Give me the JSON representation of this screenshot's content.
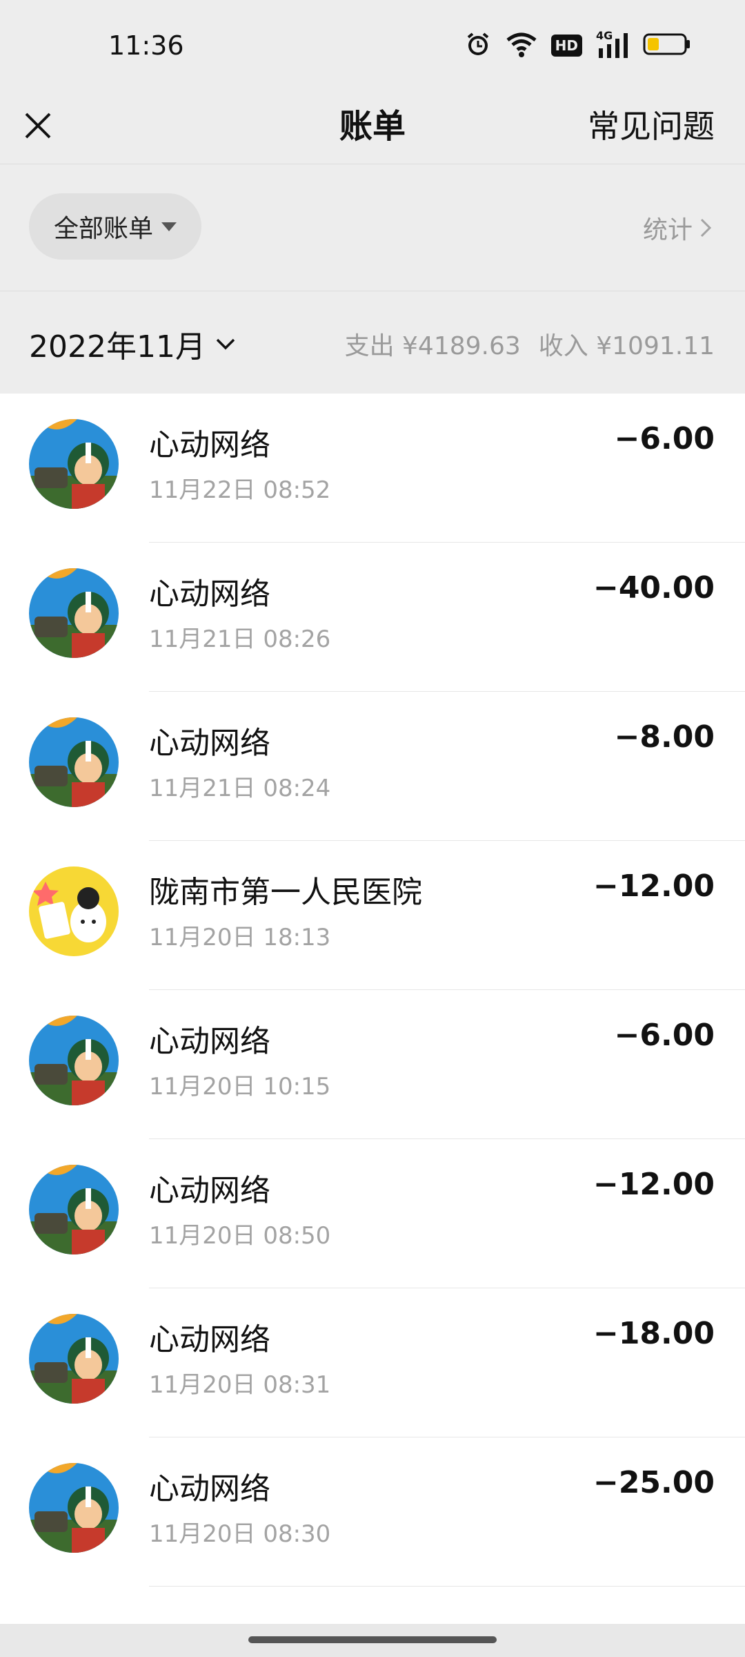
{
  "status": {
    "time": "11:36",
    "icons": [
      "alarm-icon",
      "wifi-icon",
      "hd-icon",
      "signal-4g-icon",
      "battery-icon"
    ],
    "hd": "HD",
    "net": "4G"
  },
  "nav": {
    "title": "账单",
    "faq": "常见问题"
  },
  "filter": {
    "label": "全部账单",
    "stats": "统计"
  },
  "month": {
    "label": "2022年11月",
    "expense": "支出 ¥4189.63",
    "income": "收入 ¥1091.11"
  },
  "transactions": [
    {
      "name": "心动网络",
      "time": "11月22日 08:52",
      "amount": "−6.00",
      "avatar": "game-avatar"
    },
    {
      "name": "心动网络",
      "time": "11月21日 08:26",
      "amount": "−40.00",
      "avatar": "game-avatar"
    },
    {
      "name": "心动网络",
      "time": "11月21日 08:24",
      "amount": "−8.00",
      "avatar": "game-avatar"
    },
    {
      "name": "陇南市第一人民医院",
      "time": "11月20日 18:13",
      "amount": "−12.00",
      "avatar": "hospital-avatar"
    },
    {
      "name": "心动网络",
      "time": "11月20日 10:15",
      "amount": "−6.00",
      "avatar": "game-avatar"
    },
    {
      "name": "心动网络",
      "time": "11月20日 08:50",
      "amount": "−12.00",
      "avatar": "game-avatar"
    },
    {
      "name": "心动网络",
      "time": "11月20日 08:31",
      "amount": "−18.00",
      "avatar": "game-avatar"
    },
    {
      "name": "心动网络",
      "time": "11月20日 08:30",
      "amount": "−25.00",
      "avatar": "game-avatar"
    }
  ]
}
